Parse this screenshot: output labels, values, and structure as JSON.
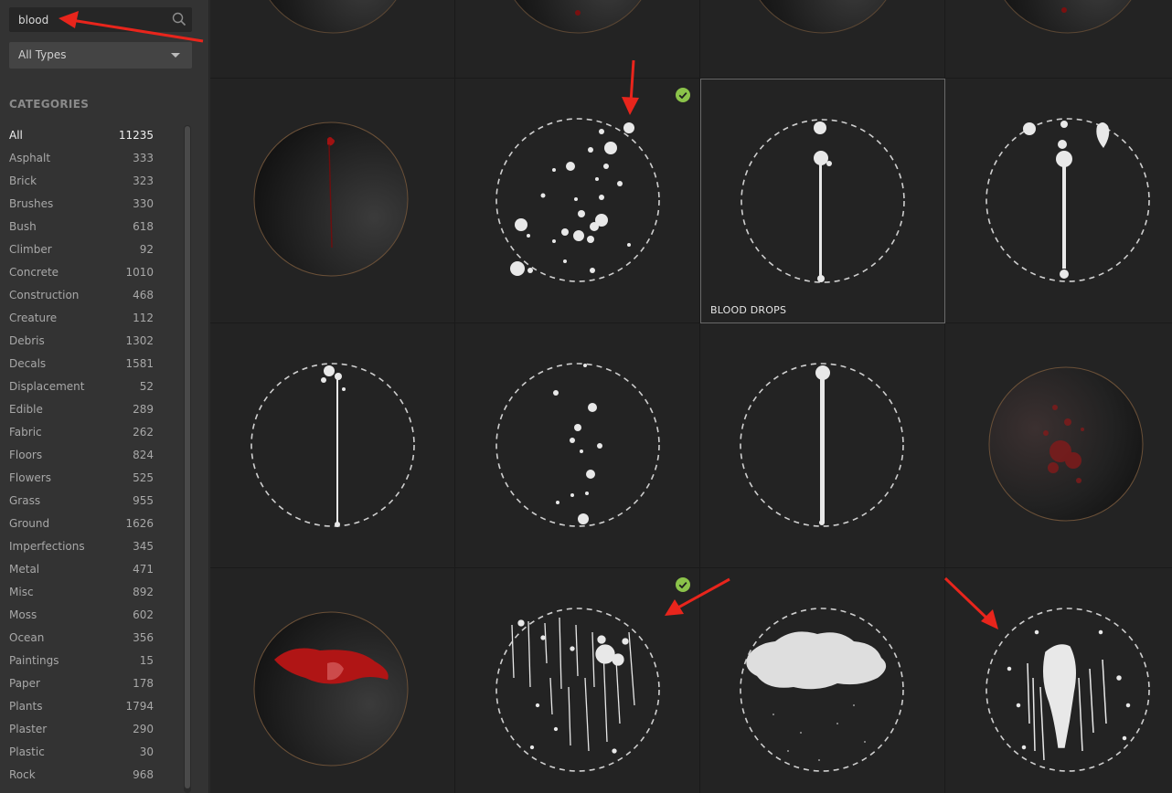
{
  "search": {
    "value": "blood",
    "placeholder": "Search"
  },
  "type_filter": {
    "selected": "All Types"
  },
  "categories": {
    "title": "CATEGORIES",
    "items": [
      {
        "label": "All",
        "count": "11235",
        "active": true
      },
      {
        "label": "Asphalt",
        "count": "333"
      },
      {
        "label": "Brick",
        "count": "323"
      },
      {
        "label": "Brushes",
        "count": "330"
      },
      {
        "label": "Bush",
        "count": "618"
      },
      {
        "label": "Climber",
        "count": "92"
      },
      {
        "label": "Concrete",
        "count": "1010"
      },
      {
        "label": "Construction",
        "count": "468"
      },
      {
        "label": "Creature",
        "count": "112"
      },
      {
        "label": "Debris",
        "count": "1302"
      },
      {
        "label": "Decals",
        "count": "1581"
      },
      {
        "label": "Displacement",
        "count": "52"
      },
      {
        "label": "Edible",
        "count": "289"
      },
      {
        "label": "Fabric",
        "count": "262"
      },
      {
        "label": "Floors",
        "count": "824"
      },
      {
        "label": "Flowers",
        "count": "525"
      },
      {
        "label": "Grass",
        "count": "955"
      },
      {
        "label": "Ground",
        "count": "1626"
      },
      {
        "label": "Imperfections",
        "count": "345"
      },
      {
        "label": "Metal",
        "count": "471"
      },
      {
        "label": "Misc",
        "count": "892"
      },
      {
        "label": "Moss",
        "count": "602"
      },
      {
        "label": "Ocean",
        "count": "356"
      },
      {
        "label": "Paintings",
        "count": "15"
      },
      {
        "label": "Paper",
        "count": "178"
      },
      {
        "label": "Plants",
        "count": "1794"
      },
      {
        "label": "Plaster",
        "count": "290"
      },
      {
        "label": "Plastic",
        "count": "30"
      },
      {
        "label": "Rock",
        "count": "968"
      }
    ]
  },
  "grid": {
    "hovered_label": "BLOOD DROPS",
    "colors": {
      "check": "#8bc34a",
      "blood": "#b01515",
      "arrow": "#e8251c"
    }
  }
}
